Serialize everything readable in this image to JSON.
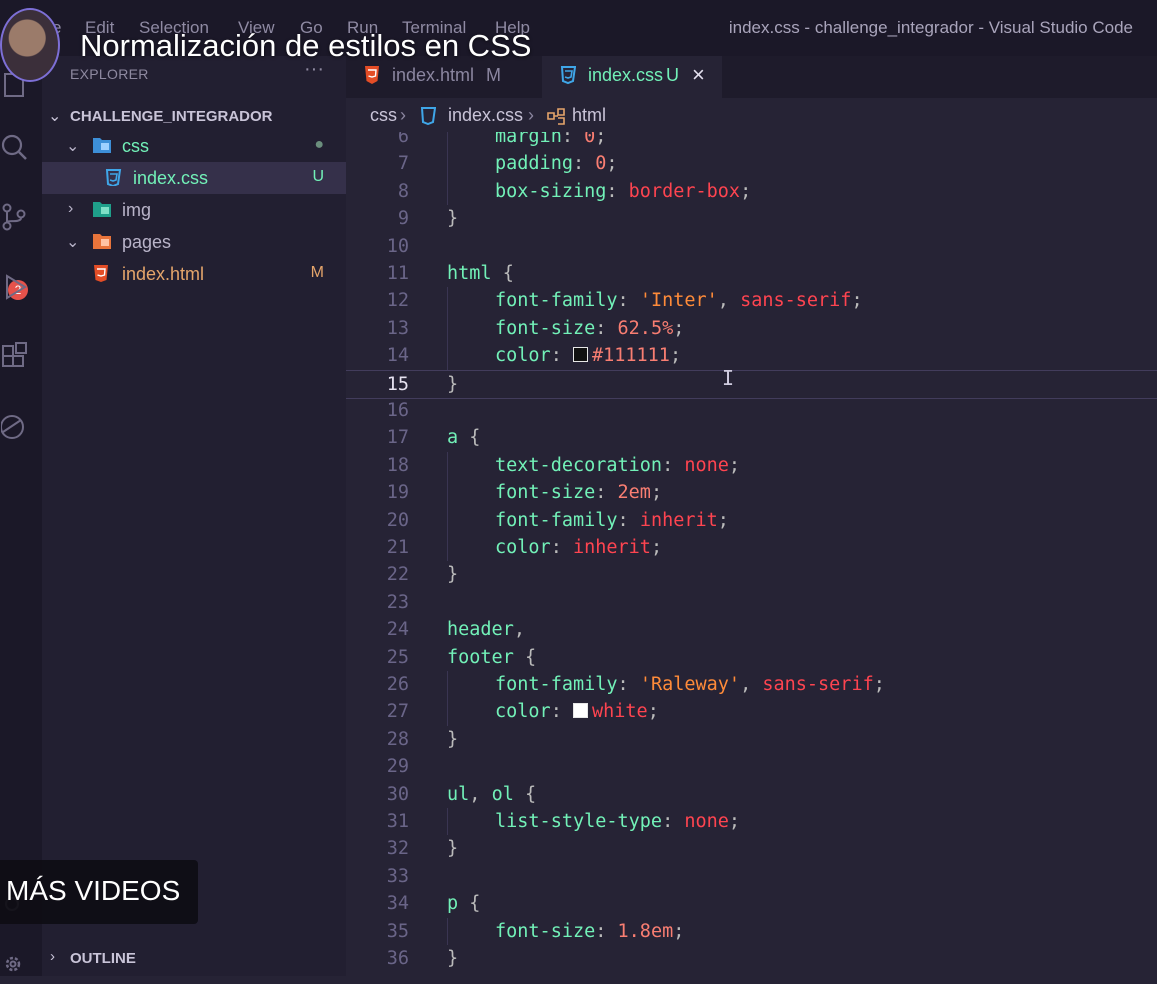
{
  "video": {
    "title": "Normalización de estilos en CSS",
    "more_videos": "MÁS VIDEOS"
  },
  "menu": [
    "e",
    "Edit",
    "Selection",
    "View",
    "Go",
    "Run",
    "Terminal",
    "Help"
  ],
  "window_title": "index.css - challenge_integrador - Visual Studio Code",
  "activity_bar": {
    "icons": [
      "files-icon",
      "search-icon",
      "source-control-icon",
      "run-debug-icon",
      "extensions-icon",
      "remote-icon",
      "account-icon",
      "settings-gear-icon"
    ],
    "source_control_badge": "2"
  },
  "sidebar": {
    "title": "EXPLORER",
    "more": "···",
    "project": "CHALLENGE_INTEGRADOR",
    "tree": [
      {
        "label": "css",
        "type": "folder",
        "expanded": true,
        "status": "●"
      },
      {
        "label": "index.css",
        "type": "css-file",
        "status": "U",
        "selected": true
      },
      {
        "label": "img",
        "type": "folder",
        "expanded": false,
        "status": ""
      },
      {
        "label": "pages",
        "type": "folder",
        "expanded": true,
        "status": ""
      },
      {
        "label": "index.html",
        "type": "html-file",
        "status": "M"
      }
    ],
    "outline": "OUTLINE"
  },
  "tabs": [
    {
      "label": "index.html",
      "status": "M",
      "active": false
    },
    {
      "label": "index.css",
      "status": "U",
      "active": true
    }
  ],
  "breadcrumb": [
    "css",
    "index.css",
    "html"
  ],
  "colors": {
    "selector": "#72f1b8",
    "property": "#72f1b8",
    "value": "#fe4450",
    "string": "#ff8b39",
    "number": "#f97e72",
    "tab_accent": "#ff2d96"
  },
  "editor": {
    "current_line": 15,
    "lines": [
      {
        "n": "6",
        "indent": 1,
        "tokens": [
          [
            "prop",
            "margin"
          ],
          [
            "punc",
            ": "
          ],
          [
            "num",
            "0"
          ],
          [
            "punc",
            ";"
          ]
        ]
      },
      {
        "n": "7",
        "indent": 1,
        "tokens": [
          [
            "prop",
            "padding"
          ],
          [
            "punc",
            ": "
          ],
          [
            "num",
            "0"
          ],
          [
            "punc",
            ";"
          ]
        ]
      },
      {
        "n": "8",
        "indent": 1,
        "tokens": [
          [
            "prop",
            "box-sizing"
          ],
          [
            "punc",
            ": "
          ],
          [
            "val",
            "border-box"
          ],
          [
            "punc",
            ";"
          ]
        ]
      },
      {
        "n": "9",
        "indent": 0,
        "tokens": [
          [
            "punc",
            "}"
          ]
        ]
      },
      {
        "n": "10",
        "indent": 0,
        "tokens": []
      },
      {
        "n": "11",
        "indent": 0,
        "tokens": [
          [
            "sel",
            "html"
          ],
          [
            "punc",
            " {"
          ]
        ]
      },
      {
        "n": "12",
        "indent": 1,
        "tokens": [
          [
            "prop",
            "font-family"
          ],
          [
            "punc",
            ": "
          ],
          [
            "str",
            "'Inter'"
          ],
          [
            "punc",
            ", "
          ],
          [
            "val",
            "sans-serif"
          ],
          [
            "punc",
            ";"
          ]
        ]
      },
      {
        "n": "13",
        "indent": 1,
        "tokens": [
          [
            "prop",
            "font-size"
          ],
          [
            "punc",
            ": "
          ],
          [
            "num",
            "62.5%"
          ],
          [
            "punc",
            ";"
          ]
        ]
      },
      {
        "n": "14",
        "indent": 1,
        "tokens": [
          [
            "prop",
            "color"
          ],
          [
            "punc",
            ": "
          ],
          [
            "swatch",
            "#111111"
          ],
          [
            "num",
            "#111111"
          ],
          [
            "punc",
            ";"
          ]
        ]
      },
      {
        "n": "15",
        "indent": 0,
        "tokens": [
          [
            "punc",
            "}"
          ]
        ]
      },
      {
        "n": "16",
        "indent": 0,
        "tokens": []
      },
      {
        "n": "17",
        "indent": 0,
        "tokens": [
          [
            "sel",
            "a"
          ],
          [
            "punc",
            " {"
          ]
        ]
      },
      {
        "n": "18",
        "indent": 1,
        "tokens": [
          [
            "prop",
            "text-decoration"
          ],
          [
            "punc",
            ": "
          ],
          [
            "val",
            "none"
          ],
          [
            "punc",
            ";"
          ]
        ]
      },
      {
        "n": "19",
        "indent": 1,
        "tokens": [
          [
            "prop",
            "font-size"
          ],
          [
            "punc",
            ": "
          ],
          [
            "num",
            "2em"
          ],
          [
            "punc",
            ";"
          ]
        ]
      },
      {
        "n": "20",
        "indent": 1,
        "tokens": [
          [
            "prop",
            "font-family"
          ],
          [
            "punc",
            ": "
          ],
          [
            "val",
            "inherit"
          ],
          [
            "punc",
            ";"
          ]
        ]
      },
      {
        "n": "21",
        "indent": 1,
        "tokens": [
          [
            "prop",
            "color"
          ],
          [
            "punc",
            ": "
          ],
          [
            "val",
            "inherit"
          ],
          [
            "punc",
            ";"
          ]
        ]
      },
      {
        "n": "22",
        "indent": 0,
        "tokens": [
          [
            "punc",
            "}"
          ]
        ]
      },
      {
        "n": "23",
        "indent": 0,
        "tokens": []
      },
      {
        "n": "24",
        "indent": 0,
        "tokens": [
          [
            "sel",
            "header"
          ],
          [
            "punc",
            ","
          ]
        ]
      },
      {
        "n": "25",
        "indent": 0,
        "tokens": [
          [
            "sel",
            "footer"
          ],
          [
            "punc",
            " {"
          ]
        ]
      },
      {
        "n": "26",
        "indent": 1,
        "tokens": [
          [
            "prop",
            "font-family"
          ],
          [
            "punc",
            ": "
          ],
          [
            "str",
            "'Raleway'"
          ],
          [
            "punc",
            ", "
          ],
          [
            "val",
            "sans-serif"
          ],
          [
            "punc",
            ";"
          ]
        ]
      },
      {
        "n": "27",
        "indent": 1,
        "tokens": [
          [
            "prop",
            "color"
          ],
          [
            "punc",
            ": "
          ],
          [
            "swatch",
            "#ffffff"
          ],
          [
            "val",
            "white"
          ],
          [
            "punc",
            ";"
          ]
        ]
      },
      {
        "n": "28",
        "indent": 0,
        "tokens": [
          [
            "punc",
            "}"
          ]
        ]
      },
      {
        "n": "29",
        "indent": 0,
        "tokens": []
      },
      {
        "n": "30",
        "indent": 0,
        "tokens": [
          [
            "sel",
            "ul"
          ],
          [
            "punc",
            ", "
          ],
          [
            "sel",
            "ol"
          ],
          [
            "punc",
            " {"
          ]
        ]
      },
      {
        "n": "31",
        "indent": 1,
        "tokens": [
          [
            "prop",
            "list-style-type"
          ],
          [
            "punc",
            ": "
          ],
          [
            "val",
            "none"
          ],
          [
            "punc",
            ";"
          ]
        ]
      },
      {
        "n": "32",
        "indent": 0,
        "tokens": [
          [
            "punc",
            "}"
          ]
        ]
      },
      {
        "n": "33",
        "indent": 0,
        "tokens": []
      },
      {
        "n": "34",
        "indent": 0,
        "tokens": [
          [
            "sel",
            "p"
          ],
          [
            "punc",
            " {"
          ]
        ]
      },
      {
        "n": "35",
        "indent": 1,
        "tokens": [
          [
            "prop",
            "font-size"
          ],
          [
            "punc",
            ": "
          ],
          [
            "num",
            "1.8em"
          ],
          [
            "punc",
            ";"
          ]
        ]
      },
      {
        "n": "36",
        "indent": 0,
        "tokens": [
          [
            "punc",
            "}"
          ]
        ]
      }
    ]
  }
}
